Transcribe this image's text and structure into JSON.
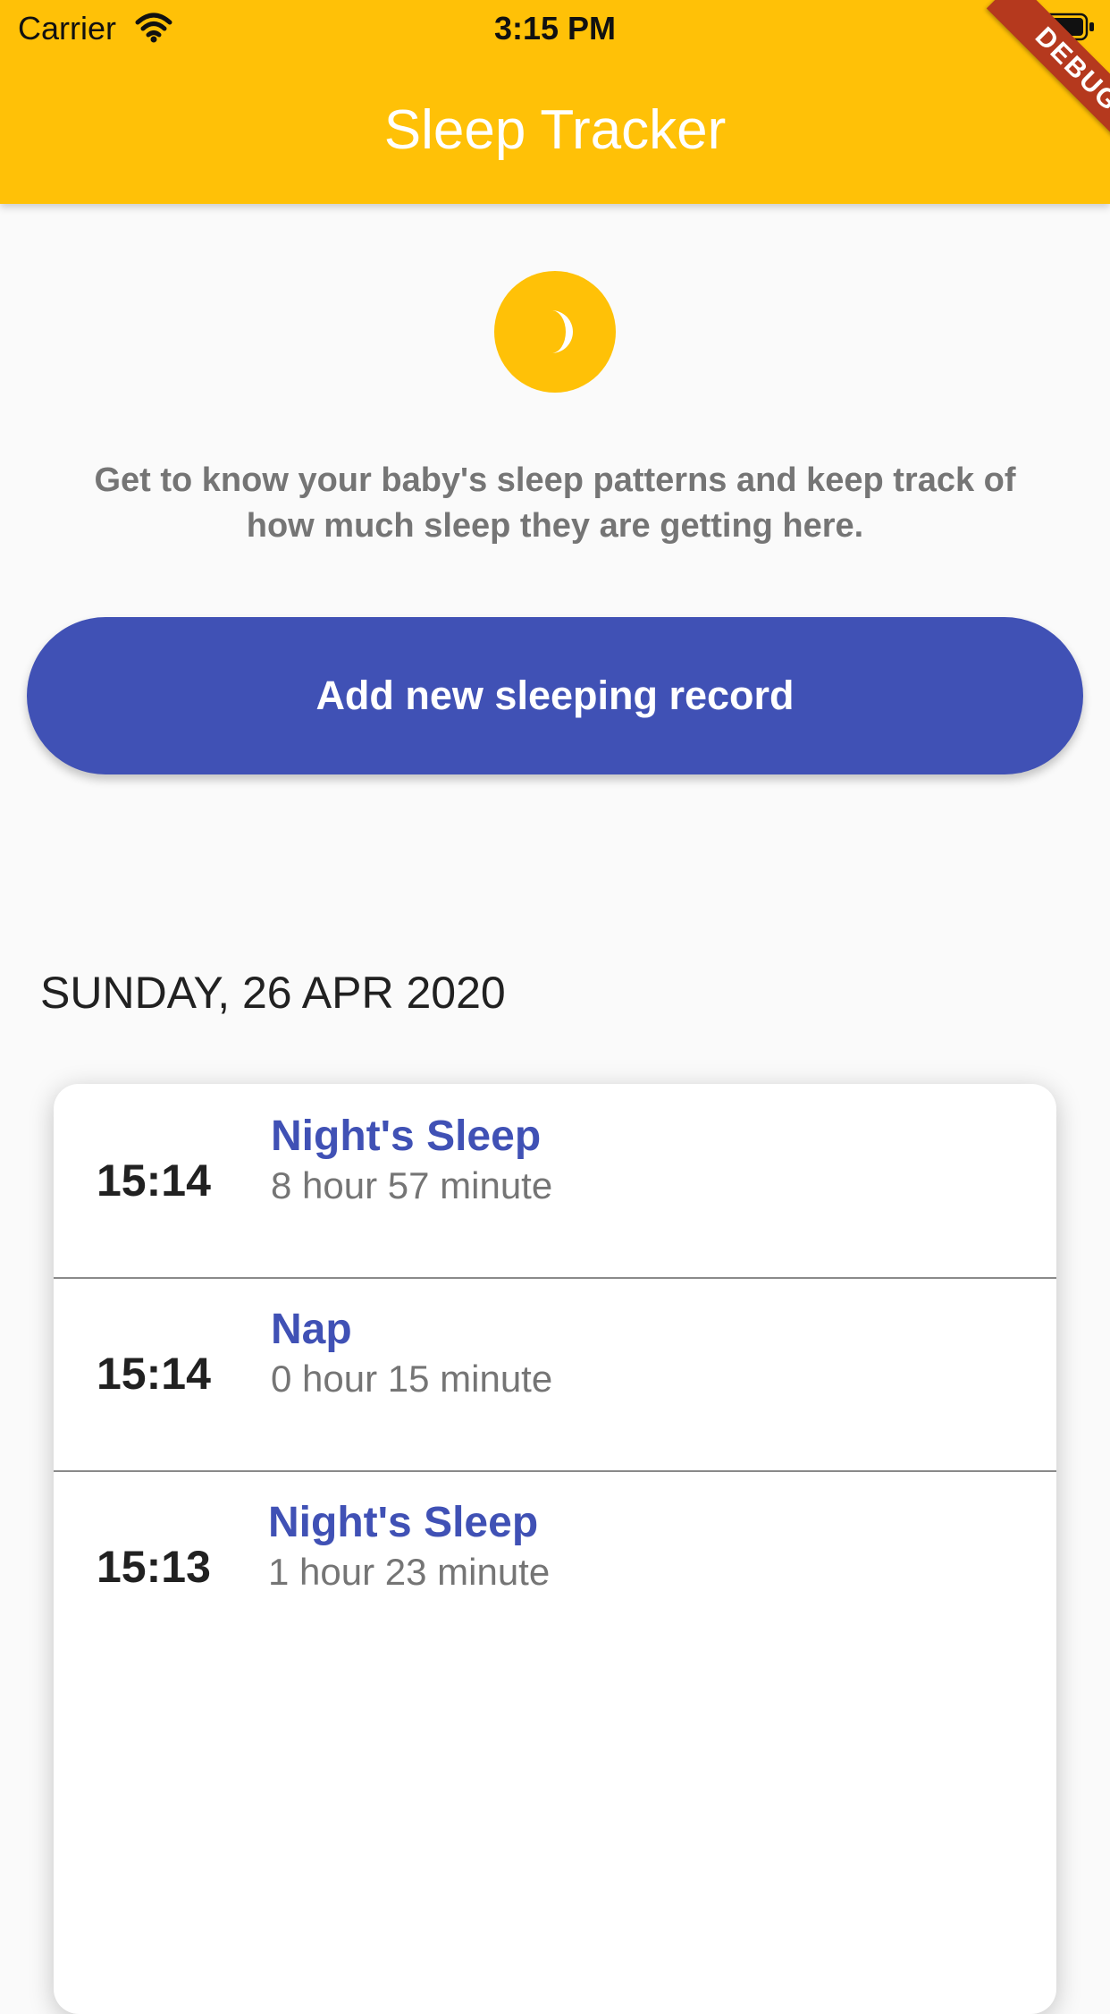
{
  "status_bar": {
    "carrier": "Carrier",
    "time": "3:15 PM"
  },
  "app_bar": {
    "title": "Sleep Tracker",
    "background_color": "#ffc107",
    "debug_banner": "DEBUG"
  },
  "intro": {
    "icon": "moon-icon",
    "text": "Get to know your baby's sleep patterns and keep track of how much sleep they are getting here."
  },
  "add_button": {
    "label": "Add new sleeping record",
    "color": "#4051b5"
  },
  "date_heading": "SUNDAY, 26 APR 2020",
  "records": [
    {
      "time": "15:14",
      "type": "Night's Sleep",
      "duration": "8 hour 57 minute"
    },
    {
      "time": "15:14",
      "type": "Nap",
      "duration": "0 hour 15 minute"
    },
    {
      "time": "15:13",
      "type": "Night's Sleep",
      "duration": "1 hour 23 minute"
    }
  ]
}
